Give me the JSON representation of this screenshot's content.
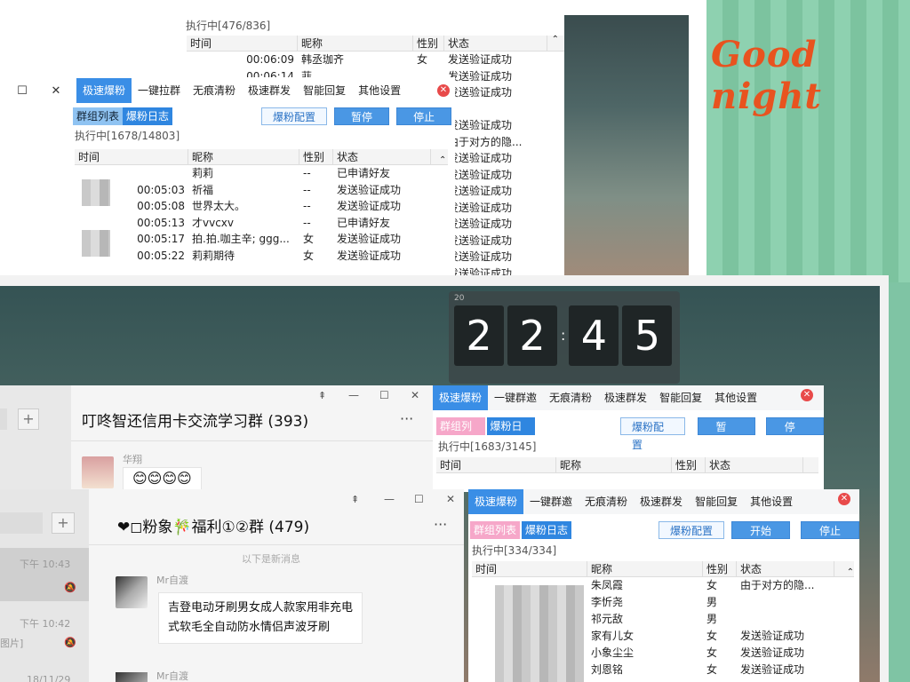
{
  "top": {
    "right_win": {
      "status": "执行中[476/836]",
      "cols": [
        "时间",
        "昵称",
        "性别",
        "状态"
      ],
      "rows": [
        {
          "time": "00:06:09",
          "nick": "韩丞珈齐",
          "gender": "女",
          "status": "发送验证成功"
        },
        {
          "time": "00:06:14",
          "nick": "菲",
          "gender": "",
          "status": "发送验证成功"
        },
        {
          "time": "",
          "nick": "",
          "gender": "",
          "status": "发送验证成功"
        },
        {
          "time": "",
          "nick": "",
          "gender": "",
          "status": ""
        },
        {
          "time": "",
          "nick": "",
          "gender": "",
          "status": "发送验证成功"
        },
        {
          "time": "",
          "nick": "",
          "gender": "",
          "status": "由于对方的隐..."
        },
        {
          "time": "",
          "nick": "",
          "gender": "",
          "status": "发送验证成功"
        },
        {
          "time": "",
          "nick": "",
          "gender": "",
          "status": "发送验证成功"
        },
        {
          "time": "",
          "nick": "",
          "gender": "",
          "status": "发送验证成功"
        },
        {
          "time": "",
          "nick": "",
          "gender": "",
          "status": "发送验证成功"
        },
        {
          "time": "",
          "nick": "",
          "gender": "",
          "status": "发送验证成功"
        },
        {
          "time": "",
          "nick": "",
          "gender": "",
          "status": "发送验证成功"
        },
        {
          "time": "",
          "nick": "",
          "gender": "",
          "status": "发送验证成功"
        },
        {
          "time": "",
          "nick": "",
          "gender": "",
          "status": "发送验证成功"
        }
      ]
    },
    "front_win": {
      "tabs": [
        "极速爆粉",
        "一键拉群",
        "无痕清粉",
        "极速群发",
        "智能回复",
        "其他设置"
      ],
      "sub_group": "群组列表",
      "sub_log": "爆粉日志",
      "btn_config": "爆粉配置",
      "btn_pause": "暂停",
      "btn_stop": "停止",
      "status": "执行中[1678/14803]",
      "cols": [
        "时间",
        "昵称",
        "性别",
        "状态"
      ],
      "rows": [
        {
          "time": "",
          "nick": "莉莉",
          "gender": "--",
          "status": "已申请好友"
        },
        {
          "time": "00:05:03",
          "nick": "祈福",
          "gender": "--",
          "status": "发送验证成功"
        },
        {
          "time": "00:05:08",
          "nick": "世界太大。",
          "gender": "--",
          "status": "发送验证成功"
        },
        {
          "time": "00:05:13",
          "nick": "才vvcxv",
          "gender": "--",
          "status": "已申请好友"
        },
        {
          "time": "00:05:17",
          "nick": "拍.拍.咖主辛; ggg...",
          "gender": "女",
          "status": "发送验证成功"
        },
        {
          "time": "00:05:22",
          "nick": "莉莉期待",
          "gender": "女",
          "status": "发送验证成功"
        }
      ]
    },
    "goodnight": "Good night"
  },
  "clock": {
    "digits": [
      "2",
      "2",
      "4",
      "5"
    ],
    "label": "20"
  },
  "bottom": {
    "chat1": {
      "title": "叮咚智还信用卡交流学习群 (393)",
      "sender": "华翔",
      "emojis": "😊😊😊😊",
      "plus": "+",
      "more": "···"
    },
    "chat2": {
      "title": "❤◻粉象🎋福利①②群 (479)",
      "new_msg": "以下是新消息",
      "sender": "Mr自渡",
      "message": "吉登电动牙刷男女成人款家用非充电式软毛全自动防水情侣声波牙刷",
      "sender2": "Mr自渡",
      "plus": "+",
      "more": "···",
      "list": [
        {
          "time": "下午 10:43"
        },
        {
          "time": "下午 10:42",
          "text": "图片]"
        },
        {
          "time": "18/11/29"
        }
      ]
    },
    "tool1": {
      "tabs": [
        "极速爆粉",
        "一键群邀",
        "无痕清粉",
        "极速群发",
        "智能回复",
        "其他设置"
      ],
      "sub_group": "群组列表",
      "sub_log": "爆粉日志",
      "btn_config": "爆粉配置",
      "btn_pause": "暂停",
      "btn_stop": "停止",
      "status": "执行中[1683/3145]",
      "cols": [
        "时间",
        "昵称",
        "性别",
        "状态"
      ]
    },
    "tool2": {
      "tabs": [
        "极速爆粉",
        "一键群邀",
        "无痕清粉",
        "极速群发",
        "智能回复",
        "其他设置"
      ],
      "sub_group": "群组列表",
      "sub_log": "爆粉日志",
      "btn_config": "爆粉配置",
      "btn_start": "开始",
      "btn_stop": "停止",
      "status": "执行中[334/334]",
      "cols": [
        "时间",
        "昵称",
        "性别",
        "状态"
      ],
      "rows": [
        {
          "nick": "朱凤霞",
          "gender": "女",
          "status": "由于对方的隐..."
        },
        {
          "nick": "李忻尧",
          "gender": "男",
          "status": ""
        },
        {
          "nick": "祁元敌",
          "gender": "男",
          "status": ""
        },
        {
          "nick": "家有儿女",
          "gender": "女",
          "status": "发送验证成功"
        },
        {
          "nick": "小象尘尘",
          "gender": "女",
          "status": "发送验证成功"
        },
        {
          "nick": "刘恩铭",
          "gender": "女",
          "status": "发送验证成功"
        }
      ]
    }
  }
}
